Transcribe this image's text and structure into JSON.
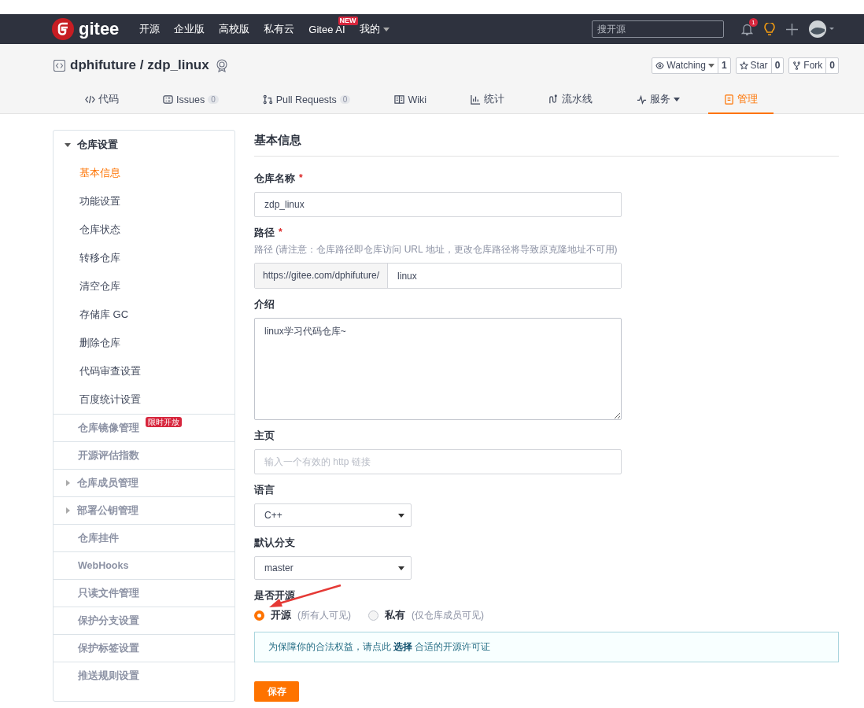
{
  "navbar": {
    "logo": "gitee",
    "links": [
      {
        "label": "开源"
      },
      {
        "label": "企业版"
      },
      {
        "label": "高校版"
      },
      {
        "label": "私有云"
      },
      {
        "label": "Gitee AI",
        "badge": "NEW"
      },
      {
        "label": "我的",
        "dropdown": true
      }
    ],
    "search": {
      "placeholder": "搜开源"
    },
    "notification_count": "1"
  },
  "repo": {
    "owner": "dphifuture",
    "separator": "/",
    "name": "zdp_linux",
    "actions": [
      {
        "kind": "watch",
        "label": "Watching",
        "dropdown": true,
        "count": "1"
      },
      {
        "kind": "star",
        "label": "Star",
        "count": "0"
      },
      {
        "kind": "fork",
        "label": "Fork",
        "count": "0"
      }
    ]
  },
  "tabs": [
    {
      "kind": "code",
      "label": "代码",
      "selected": false
    },
    {
      "kind": "issues",
      "label": "Issues",
      "count": "0",
      "selected": false
    },
    {
      "kind": "pulls",
      "label": "Pull Requests",
      "count": "0",
      "selected": false
    },
    {
      "kind": "wiki",
      "label": "Wiki",
      "selected": false
    },
    {
      "kind": "stats",
      "label": "统计",
      "selected": false
    },
    {
      "kind": "pipeline",
      "label": "流水线",
      "selected": false
    },
    {
      "kind": "services",
      "label": "服务",
      "dropdown": true,
      "selected": false
    },
    {
      "kind": "manage",
      "label": "管理",
      "selected": true
    }
  ],
  "sidebar": {
    "sections": [
      {
        "kind": "group",
        "label": "仓库设置",
        "expanded": true,
        "children": [
          {
            "label": "基本信息",
            "selected": true
          },
          {
            "label": "功能设置",
            "selected": false
          },
          {
            "label": "仓库状态",
            "selected": false
          },
          {
            "label": "转移仓库",
            "selected": false
          },
          {
            "label": "清空仓库",
            "selected": false
          },
          {
            "label": "存储库 GC",
            "selected": false
          },
          {
            "label": "删除仓库",
            "selected": false
          },
          {
            "label": "代码审查设置",
            "selected": false
          },
          {
            "label": "百度统计设置",
            "selected": false
          }
        ]
      },
      {
        "kind": "link",
        "label": "仓库镜像管理",
        "badge": "限时开放"
      },
      {
        "kind": "link",
        "label": "开源评估指数"
      },
      {
        "kind": "group",
        "label": "仓库成员管理",
        "expanded": false
      },
      {
        "kind": "group",
        "label": "部署公钥管理",
        "expanded": false
      },
      {
        "kind": "link",
        "label": "仓库挂件"
      },
      {
        "kind": "link",
        "label": "WebHooks"
      },
      {
        "kind": "link",
        "label": "只读文件管理"
      },
      {
        "kind": "link",
        "label": "保护分支设置"
      },
      {
        "kind": "link",
        "label": "保护标签设置"
      },
      {
        "kind": "link",
        "label": "推送规则设置"
      }
    ]
  },
  "form": {
    "title": "基本信息",
    "fields": [
      {
        "kind": "text",
        "label": "仓库名称",
        "required_mark": "*",
        "value": "zdp_linux"
      },
      {
        "kind": "prefixed",
        "label": "路径",
        "required_mark": "*",
        "hint": "路径 (请注意：仓库路径即仓库访问 URL 地址，更改仓库路径将导致原克隆地址不可用)",
        "prefix": "https://gitee.com/dphifuture/",
        "value": "linux"
      },
      {
        "kind": "textarea",
        "label": "介绍",
        "value": "linux学习代码仓库~"
      },
      {
        "kind": "text",
        "label": "主页",
        "placeholder": "输入一个有效的 http 链接"
      },
      {
        "kind": "select",
        "label": "语言",
        "value": "C++"
      },
      {
        "kind": "select",
        "label": "默认分支",
        "value": "master"
      },
      {
        "kind": "radio",
        "label": "是否开源",
        "options": [
          {
            "label": "开源",
            "note": "(所有人可见)",
            "selected": true
          },
          {
            "label": "私有",
            "note": "(仅仓库成员可见)",
            "selected": false
          }
        ]
      }
    ],
    "notice": {
      "before": "为保障你的合法权益，请点此 ",
      "link": "选择",
      "after": " 合适的开源许可证"
    },
    "submit": "保存"
  }
}
